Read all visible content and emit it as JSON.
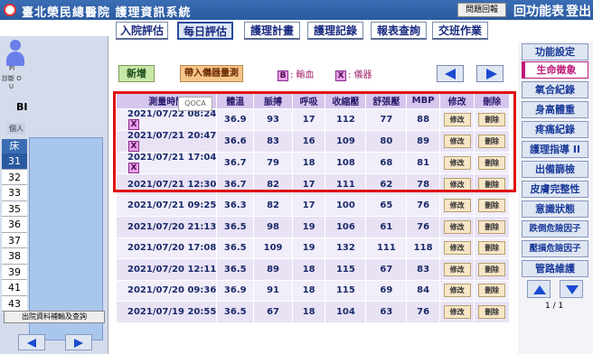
{
  "titlebar": {
    "hospital": "臺北榮民總醫院",
    "system": "護理資訊系統",
    "problem_report": "問題回報",
    "menu": "回功能表",
    "logout": "登出"
  },
  "topnav": [
    "入院評估",
    "每日評估",
    "護理計畫",
    "護理記錄",
    "報表查詢",
    "交班作業"
  ],
  "topnav_active": "每日評估",
  "left": {
    "pinfo_lines": [
      "PI",
      "診斷 O",
      "U"
    ],
    "bi_label": "BI",
    "person_label": "個人",
    "bed_header": "床",
    "beds": [
      "31",
      "32",
      "33",
      "35",
      "36",
      "37",
      "38",
      "39",
      "41",
      "43"
    ],
    "selected_bed": "31",
    "discharge_label": "出院資料補輸及查詢"
  },
  "main": {
    "add_label": "新增",
    "device_label": "帶入儀器量測",
    "legend_b_tag": "B",
    "legend_b_text": ": 輸血",
    "legend_x_tag": "X",
    "legend_x_text": ": 儀器",
    "qoca_label": "QOCA",
    "columns": [
      "測量時間",
      "體溫",
      "脈搏",
      "呼吸",
      "收縮壓",
      "舒張壓",
      "MBP",
      "修改",
      "刪除"
    ],
    "edit_label": "修改",
    "delete_label": "刪除",
    "rows": [
      {
        "time": "2021/07/22 08:24",
        "tag": "X",
        "temp": "36.9",
        "pulse": "93",
        "resp": "17",
        "sbp": "112",
        "dbp": "77",
        "mbp": "88"
      },
      {
        "time": "2021/07/21 20:47",
        "tag": "X",
        "temp": "36.6",
        "pulse": "83",
        "resp": "16",
        "sbp": "109",
        "dbp": "80",
        "mbp": "89"
      },
      {
        "time": "2021/07/21 17:04",
        "tag": "X",
        "temp": "36.7",
        "pulse": "79",
        "resp": "18",
        "sbp": "108",
        "dbp": "68",
        "mbp": "81"
      },
      {
        "time": "2021/07/21 12:30",
        "tag": "",
        "temp": "36.7",
        "pulse": "82",
        "resp": "17",
        "sbp": "111",
        "dbp": "62",
        "mbp": "78"
      },
      {
        "time": "2021/07/21 09:25",
        "tag": "",
        "temp": "36.3",
        "pulse": "82",
        "resp": "17",
        "sbp": "100",
        "dbp": "65",
        "mbp": "76"
      },
      {
        "time": "2021/07/20 21:13",
        "tag": "",
        "temp": "36.5",
        "pulse": "98",
        "resp": "19",
        "sbp": "106",
        "dbp": "61",
        "mbp": "76"
      },
      {
        "time": "2021/07/20 17:08",
        "tag": "",
        "temp": "36.5",
        "pulse": "109",
        "resp": "19",
        "sbp": "132",
        "dbp": "111",
        "mbp": "118"
      },
      {
        "time": "2021/07/20 12:11",
        "tag": "",
        "temp": "36.5",
        "pulse": "89",
        "resp": "18",
        "sbp": "115",
        "dbp": "67",
        "mbp": "83"
      },
      {
        "time": "2021/07/20 09:36",
        "tag": "",
        "temp": "36.9",
        "pulse": "91",
        "resp": "18",
        "sbp": "115",
        "dbp": "69",
        "mbp": "84"
      },
      {
        "time": "2021/07/19 20:55",
        "tag": "",
        "temp": "36.5",
        "pulse": "67",
        "resp": "18",
        "sbp": "104",
        "dbp": "63",
        "mbp": "76"
      }
    ]
  },
  "right": {
    "items": [
      "功能設定",
      "生命徵象",
      "氧合紀錄",
      "身高體重",
      "疼痛紀錄",
      "護理指導 II",
      "出備篩檢",
      "皮膚完整性",
      "意識狀態",
      "跌倒危險因子",
      "壓損危險因子",
      "管路維護"
    ],
    "active": "生命徵象",
    "page_indicator": "1 / 1"
  },
  "colors": {
    "accent": "#2a5aa0",
    "highlight_border": "#e01010",
    "active_item": "#c01a7a"
  }
}
